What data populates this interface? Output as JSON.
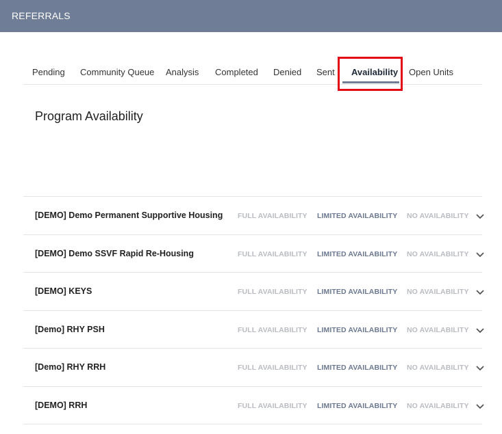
{
  "header": {
    "title": "REFERRALS"
  },
  "tabs": [
    {
      "label": "Pending"
    },
    {
      "label": "Community Queue"
    },
    {
      "label": "Analysis"
    },
    {
      "label": "Completed"
    },
    {
      "label": "Denied"
    },
    {
      "label": "Sent"
    },
    {
      "label": "Availability",
      "active": true
    },
    {
      "label": "Open Units"
    }
  ],
  "section_title": "Program Availability",
  "availability_labels": {
    "full": "FULL AVAILABILITY",
    "limited": "LIMITED AVAILABILITY",
    "none": "NO AVAILABILITY"
  },
  "programs": [
    {
      "name": "[DEMO] Demo Permanent Supportive Housing",
      "selected": "limited"
    },
    {
      "name": "[DEMO] Demo SSVF Rapid Re-Housing",
      "selected": "limited"
    },
    {
      "name": "[DEMO] KEYS",
      "selected": "limited"
    },
    {
      "name": "[Demo] RHY PSH",
      "selected": "limited"
    },
    {
      "name": "[Demo] RHY RRH",
      "selected": "limited"
    },
    {
      "name": "[DEMO] RRH",
      "selected": "limited"
    }
  ],
  "colors": {
    "header_bg": "#6f7d96",
    "highlight": "#e30613",
    "limited_text": "#6b7890",
    "muted_text": "#b9bcc2"
  },
  "icons": {
    "row_toggle": "chevron-down-icon"
  }
}
